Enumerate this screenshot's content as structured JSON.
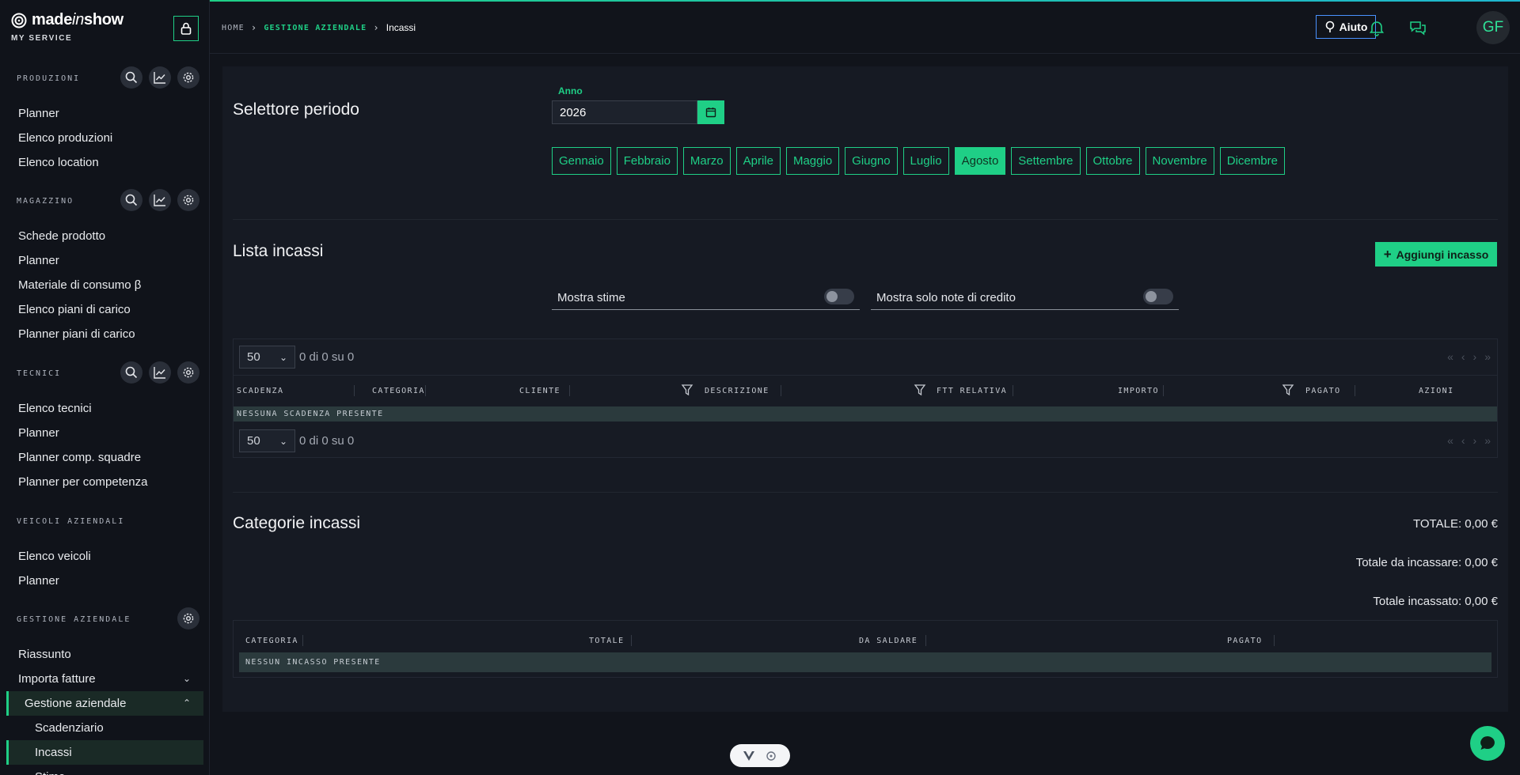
{
  "brand": {
    "name_part1": "made",
    "name_part2": "in",
    "name_part3": "show",
    "subtitle": "MY SERVICE"
  },
  "sidebar": {
    "sections": [
      {
        "title": "PRODUZIONI",
        "items": [
          "Planner",
          "Elenco produzioni",
          "Elenco location"
        ]
      },
      {
        "title": "MAGAZZINO",
        "items": [
          "Schede prodotto",
          "Planner",
          "Materiale di consumo β",
          "Elenco piani di carico",
          "Planner piani di carico"
        ]
      },
      {
        "title": "TECNICI",
        "items": [
          "Elenco tecnici",
          "Planner",
          "Planner comp. squadre",
          "Planner per competenza"
        ]
      },
      {
        "title": "VEICOLI AZIENDALI",
        "items": [
          "Elenco veicoli",
          "Planner"
        ]
      },
      {
        "title": "GESTIONE AZIENDALE",
        "items": [
          "Riassunto",
          "Importa fatture",
          "Gestione aziendale"
        ],
        "subitems": [
          "Scadenziario",
          "Incassi",
          "Stime"
        ]
      }
    ]
  },
  "breadcrumb": {
    "home": "HOME",
    "section": "GESTIONE AZIENDALE",
    "current": "Incassi"
  },
  "topbar": {
    "help_label": "Aiuto",
    "avatar_initials": "GF"
  },
  "period": {
    "title": "Selettore periodo",
    "year_label": "Anno",
    "year_value": "2026",
    "months": [
      "Gennaio",
      "Febbraio",
      "Marzo",
      "Aprile",
      "Maggio",
      "Giugno",
      "Luglio",
      "Agosto",
      "Settembre",
      "Ottobre",
      "Novembre",
      "Dicembre"
    ],
    "selected_month": "Agosto"
  },
  "incassi": {
    "title": "Lista incassi",
    "add_label": "Aggiungi incasso",
    "toggle_stime": "Mostra stime",
    "toggle_note": "Mostra solo note di credito",
    "page_size": "50",
    "page_info": "0 di 0 su 0",
    "columns": [
      "SCADENZA",
      "CATEGORIA",
      "CLIENTE",
      "DESCRIZIONE",
      "FTT RELATIVA",
      "IMPORTO",
      "PAGATO",
      "AZIONI"
    ],
    "empty_text": "NESSUNA SCADENZA PRESENTE"
  },
  "categorie": {
    "title": "Categorie incassi",
    "totale": "TOTALE: 0,00 €",
    "da_incassare": "Totale da incassare: 0,00 €",
    "incassato": "Totale incassato: 0,00 €",
    "columns": [
      "CATEGORIA",
      "TOTALE",
      "DA SALDARE",
      "PAGATO"
    ],
    "empty_text": "NESSUN INCASSO PRESENTE"
  },
  "colors": {
    "accent": "#1fcf86",
    "background": "#11141b",
    "panel": "#161a23",
    "help_border": "#4a92ff"
  },
  "icons": [
    "lock-icon",
    "search-icon",
    "chart-icon",
    "gear-icon",
    "help-icon",
    "bell-icon",
    "messages-icon",
    "calendar-icon",
    "plus-icon",
    "filter-icon",
    "chat-icon"
  ]
}
